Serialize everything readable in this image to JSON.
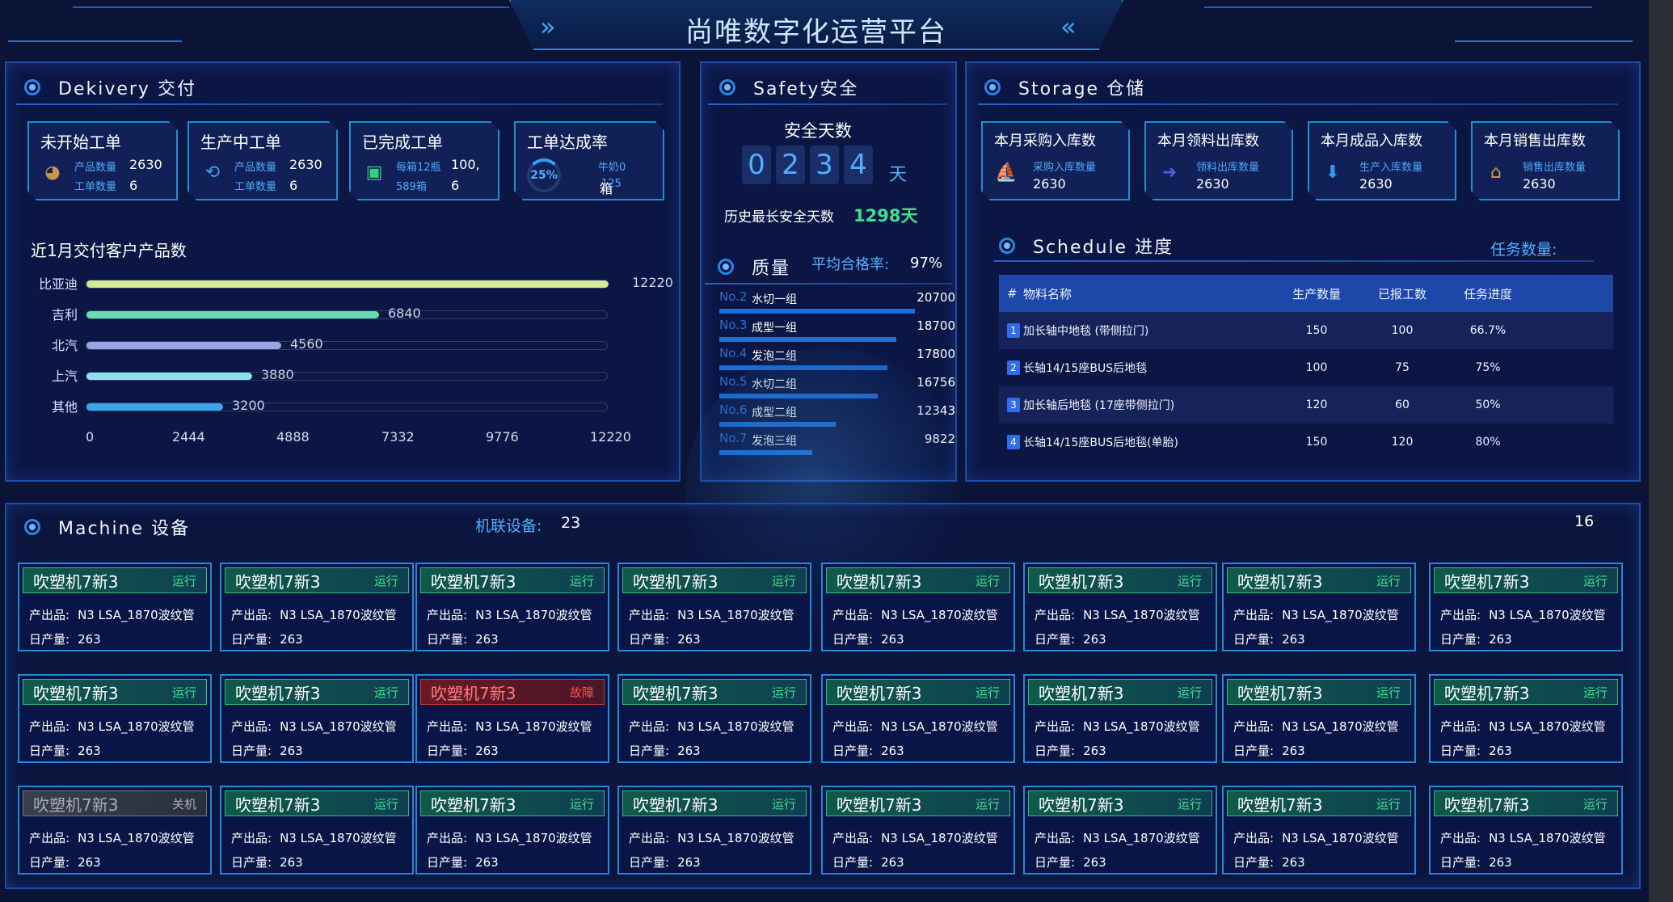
{
  "header": {
    "title": "尚唯数字化运营平台",
    "left_chev": "»",
    "right_chev": "«"
  },
  "delivery": {
    "title": "Dekivery 交付",
    "cards": [
      {
        "title": "未开始工单",
        "icon": "clock-icon",
        "l1": "产品数量",
        "v1": "2630",
        "l2": "工单数量",
        "v2": "6"
      },
      {
        "title": "生产中工单",
        "icon": "refresh-icon",
        "l1": "产品数量",
        "v1": "2630",
        "l2": "工单数量",
        "v2": "6"
      },
      {
        "title": "已完成工单",
        "icon": "briefcase-icon",
        "l1": "每箱12瓶",
        "v1": "100,",
        "l2": "589箱",
        "v2": "6"
      },
      {
        "title": "工单达成率",
        "icon": "gauge-icon",
        "gauge": "25%",
        "l1": "牛奶0",
        "v1": "",
        "l2": "125",
        "v2": "箱"
      }
    ],
    "chart_title": "近1月交付客户产品数",
    "chart_data": {
      "type": "bar",
      "categories": [
        "比亚迪",
        "吉利",
        "北汽",
        "上汽",
        "其他"
      ],
      "values": [
        12220,
        6840,
        4560,
        3880,
        3200
      ],
      "colors": [
        "#d4e89a",
        "#67dcb0",
        "#9aa5e8",
        "#8ee0e8",
        "#3aa6e8"
      ],
      "xticks": [
        "0",
        "2444",
        "4888",
        "7332",
        "9776",
        "12220"
      ],
      "xlim": [
        0,
        12220
      ]
    }
  },
  "safety": {
    "title": "Safety安全",
    "days_label": "安全天数",
    "digits": [
      "0",
      "2",
      "3",
      "4"
    ],
    "unit": "天",
    "record_label": "历史最长安全天数",
    "record_value": "1298天"
  },
  "quality": {
    "title": "质量",
    "avg_label": "平均合格率:",
    "avg_value": "97%",
    "rows": [
      {
        "no": "No.2",
        "name": "水切一组",
        "value": 20700
      },
      {
        "no": "No.3",
        "name": "成型一组",
        "value": 18700
      },
      {
        "no": "No.4",
        "name": "发泡二组",
        "value": 17800
      },
      {
        "no": "No.5",
        "name": "水切二组",
        "value": 16756
      },
      {
        "no": "No.6",
        "name": "成型二组",
        "value": 12343
      },
      {
        "no": "No.7",
        "name": "发泡三组",
        "value": 9822
      }
    ]
  },
  "storage": {
    "title": "Storage 仓储",
    "cards": [
      {
        "title": "本月采购入库数",
        "icon": "boat-icon",
        "sub": "采购入库数量",
        "value": "2630"
      },
      {
        "title": "本月领料出库数",
        "icon": "arrow-right-icon",
        "sub": "领料出库数量",
        "value": "2630"
      },
      {
        "title": "本月成品入库数",
        "icon": "download-icon",
        "sub": "生产入库数量",
        "value": "2630"
      },
      {
        "title": "本月销售出库数",
        "icon": "house-icon",
        "sub": "销售出库数量",
        "value": "2630"
      }
    ]
  },
  "schedule": {
    "title": "Schedule 进度",
    "task_label": "任务数量:",
    "headers": [
      "#",
      "物料名称",
      "生产数量",
      "已报工数",
      "任务进度"
    ],
    "rows": [
      [
        "1",
        "加长轴中地毯 (带侧拉门)",
        "150",
        "100",
        "66.7%"
      ],
      [
        "2",
        "长轴14/15座BUS后地毯",
        "100",
        "75",
        "75%"
      ],
      [
        "3",
        "加长轴后地毯 (17座带侧拉门)",
        "120",
        "60",
        "50%"
      ],
      [
        "4",
        "长轴14/15座BUS后地毯(单胎)",
        "150",
        "120",
        "80%"
      ]
    ]
  },
  "machine": {
    "title": "Machine 设备",
    "linked_label": "机联设备:",
    "linked_value": "23",
    "right_count": "16",
    "product_label": "产出品:",
    "product_value": "N3 LSA_1870波纹管",
    "daily_label": "日产量:",
    "daily_value": "263",
    "rows": [
      [
        {
          "name": "吹塑机7新3",
          "status": "运行"
        },
        {
          "name": "吹塑机7新3",
          "status": "运行"
        },
        {
          "name": "吹塑机7新3",
          "status": "运行"
        },
        {
          "name": "吹塑机7新3",
          "status": "运行"
        },
        {
          "name": "吹塑机7新3",
          "status": "运行"
        },
        {
          "name": "吹塑机7新3",
          "status": "运行"
        },
        {
          "name": "吹塑机7新3",
          "status": "运行"
        },
        {
          "name": "吹塑机7新3",
          "status": "运行"
        }
      ],
      [
        {
          "name": "吹塑机7新3",
          "status": "运行"
        },
        {
          "name": "吹塑机7新3",
          "status": "运行"
        },
        {
          "name": "吹塑机7新3",
          "status": "故障"
        },
        {
          "name": "吹塑机7新3",
          "status": "运行"
        },
        {
          "name": "吹塑机7新3",
          "status": "运行"
        },
        {
          "name": "吹塑机7新3",
          "status": "运行"
        },
        {
          "name": "吹塑机7新3",
          "status": "运行"
        },
        {
          "name": "吹塑机7新3",
          "status": "运行"
        }
      ],
      [
        {
          "name": "吹塑机7新3",
          "status": "关机"
        },
        {
          "name": "吹塑机7新3",
          "status": "运行"
        },
        {
          "name": "吹塑机7新3",
          "status": "运行"
        },
        {
          "name": "吹塑机7新3",
          "status": "运行"
        },
        {
          "name": "吹塑机7新3",
          "status": "运行"
        },
        {
          "name": "吹塑机7新3",
          "status": "运行"
        },
        {
          "name": "吹塑机7新3",
          "status": "运行"
        },
        {
          "name": "吹塑机7新3",
          "status": "运行"
        }
      ]
    ]
  }
}
